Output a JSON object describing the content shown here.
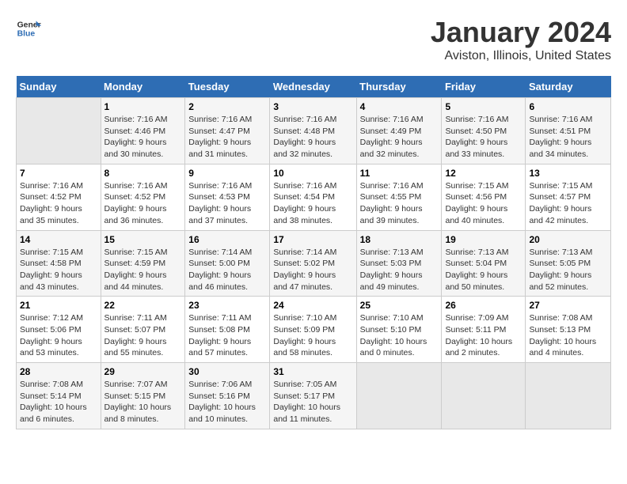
{
  "header": {
    "logo_line1": "General",
    "logo_line2": "Blue",
    "title": "January 2024",
    "subtitle": "Aviston, Illinois, United States"
  },
  "days_of_week": [
    "Sunday",
    "Monday",
    "Tuesday",
    "Wednesday",
    "Thursday",
    "Friday",
    "Saturday"
  ],
  "weeks": [
    [
      {
        "day": "",
        "info": ""
      },
      {
        "day": "1",
        "info": "Sunrise: 7:16 AM\nSunset: 4:46 PM\nDaylight: 9 hours\nand 30 minutes."
      },
      {
        "day": "2",
        "info": "Sunrise: 7:16 AM\nSunset: 4:47 PM\nDaylight: 9 hours\nand 31 minutes."
      },
      {
        "day": "3",
        "info": "Sunrise: 7:16 AM\nSunset: 4:48 PM\nDaylight: 9 hours\nand 32 minutes."
      },
      {
        "day": "4",
        "info": "Sunrise: 7:16 AM\nSunset: 4:49 PM\nDaylight: 9 hours\nand 32 minutes."
      },
      {
        "day": "5",
        "info": "Sunrise: 7:16 AM\nSunset: 4:50 PM\nDaylight: 9 hours\nand 33 minutes."
      },
      {
        "day": "6",
        "info": "Sunrise: 7:16 AM\nSunset: 4:51 PM\nDaylight: 9 hours\nand 34 minutes."
      }
    ],
    [
      {
        "day": "7",
        "info": "Sunrise: 7:16 AM\nSunset: 4:52 PM\nDaylight: 9 hours\nand 35 minutes."
      },
      {
        "day": "8",
        "info": "Sunrise: 7:16 AM\nSunset: 4:52 PM\nDaylight: 9 hours\nand 36 minutes."
      },
      {
        "day": "9",
        "info": "Sunrise: 7:16 AM\nSunset: 4:53 PM\nDaylight: 9 hours\nand 37 minutes."
      },
      {
        "day": "10",
        "info": "Sunrise: 7:16 AM\nSunset: 4:54 PM\nDaylight: 9 hours\nand 38 minutes."
      },
      {
        "day": "11",
        "info": "Sunrise: 7:16 AM\nSunset: 4:55 PM\nDaylight: 9 hours\nand 39 minutes."
      },
      {
        "day": "12",
        "info": "Sunrise: 7:15 AM\nSunset: 4:56 PM\nDaylight: 9 hours\nand 40 minutes."
      },
      {
        "day": "13",
        "info": "Sunrise: 7:15 AM\nSunset: 4:57 PM\nDaylight: 9 hours\nand 42 minutes."
      }
    ],
    [
      {
        "day": "14",
        "info": "Sunrise: 7:15 AM\nSunset: 4:58 PM\nDaylight: 9 hours\nand 43 minutes."
      },
      {
        "day": "15",
        "info": "Sunrise: 7:15 AM\nSunset: 4:59 PM\nDaylight: 9 hours\nand 44 minutes."
      },
      {
        "day": "16",
        "info": "Sunrise: 7:14 AM\nSunset: 5:00 PM\nDaylight: 9 hours\nand 46 minutes."
      },
      {
        "day": "17",
        "info": "Sunrise: 7:14 AM\nSunset: 5:02 PM\nDaylight: 9 hours\nand 47 minutes."
      },
      {
        "day": "18",
        "info": "Sunrise: 7:13 AM\nSunset: 5:03 PM\nDaylight: 9 hours\nand 49 minutes."
      },
      {
        "day": "19",
        "info": "Sunrise: 7:13 AM\nSunset: 5:04 PM\nDaylight: 9 hours\nand 50 minutes."
      },
      {
        "day": "20",
        "info": "Sunrise: 7:13 AM\nSunset: 5:05 PM\nDaylight: 9 hours\nand 52 minutes."
      }
    ],
    [
      {
        "day": "21",
        "info": "Sunrise: 7:12 AM\nSunset: 5:06 PM\nDaylight: 9 hours\nand 53 minutes."
      },
      {
        "day": "22",
        "info": "Sunrise: 7:11 AM\nSunset: 5:07 PM\nDaylight: 9 hours\nand 55 minutes."
      },
      {
        "day": "23",
        "info": "Sunrise: 7:11 AM\nSunset: 5:08 PM\nDaylight: 9 hours\nand 57 minutes."
      },
      {
        "day": "24",
        "info": "Sunrise: 7:10 AM\nSunset: 5:09 PM\nDaylight: 9 hours\nand 58 minutes."
      },
      {
        "day": "25",
        "info": "Sunrise: 7:10 AM\nSunset: 5:10 PM\nDaylight: 10 hours\nand 0 minutes."
      },
      {
        "day": "26",
        "info": "Sunrise: 7:09 AM\nSunset: 5:11 PM\nDaylight: 10 hours\nand 2 minutes."
      },
      {
        "day": "27",
        "info": "Sunrise: 7:08 AM\nSunset: 5:13 PM\nDaylight: 10 hours\nand 4 minutes."
      }
    ],
    [
      {
        "day": "28",
        "info": "Sunrise: 7:08 AM\nSunset: 5:14 PM\nDaylight: 10 hours\nand 6 minutes."
      },
      {
        "day": "29",
        "info": "Sunrise: 7:07 AM\nSunset: 5:15 PM\nDaylight: 10 hours\nand 8 minutes."
      },
      {
        "day": "30",
        "info": "Sunrise: 7:06 AM\nSunset: 5:16 PM\nDaylight: 10 hours\nand 10 minutes."
      },
      {
        "day": "31",
        "info": "Sunrise: 7:05 AM\nSunset: 5:17 PM\nDaylight: 10 hours\nand 11 minutes."
      },
      {
        "day": "",
        "info": ""
      },
      {
        "day": "",
        "info": ""
      },
      {
        "day": "",
        "info": ""
      }
    ]
  ]
}
